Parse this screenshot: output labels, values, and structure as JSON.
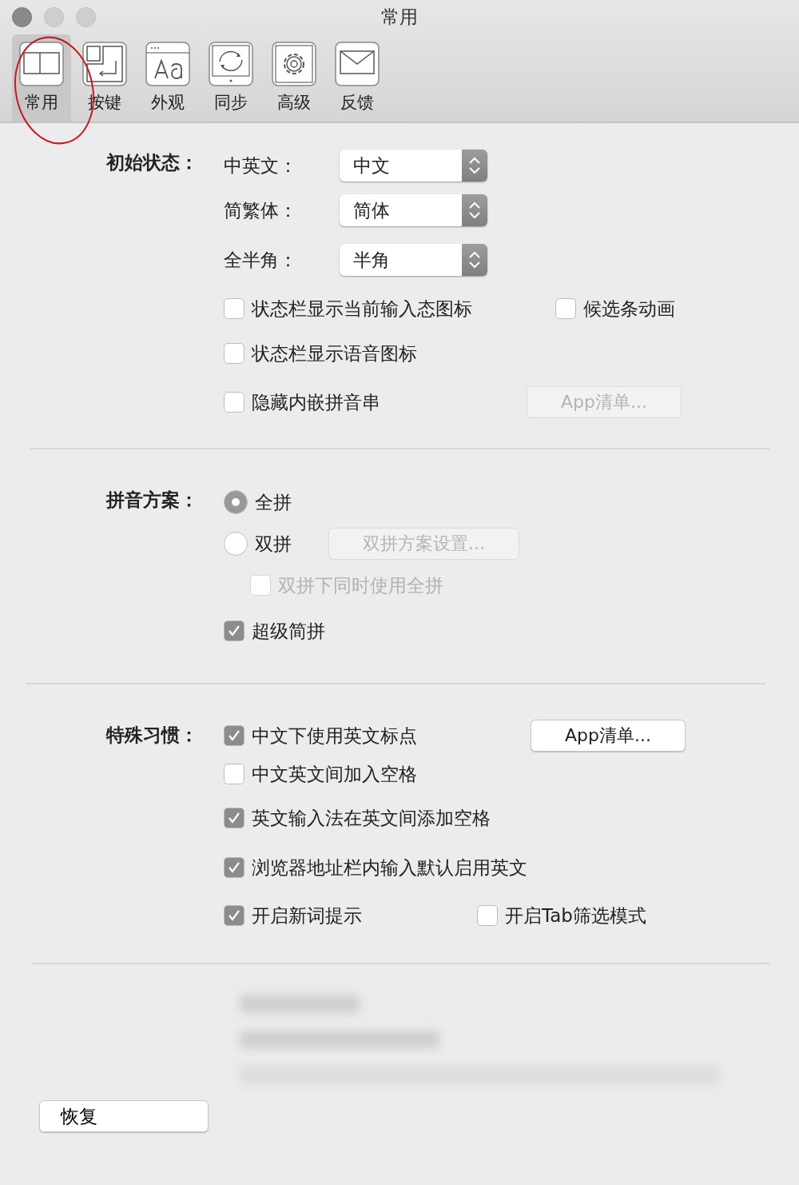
{
  "window": {
    "title": "常用"
  },
  "toolbar": [
    {
      "label": "常用",
      "selected": true
    },
    {
      "label": "按键",
      "selected": false
    },
    {
      "label": "外观",
      "selected": false
    },
    {
      "label": "同步",
      "selected": false
    },
    {
      "label": "高级",
      "selected": false
    },
    {
      "label": "反馈",
      "selected": false
    }
  ],
  "sections": [
    {
      "label": "初始状态：",
      "rows": [
        {
          "kind": "plain",
          "controls": [
            {
              "kind": "popup",
              "label": "中英文：",
              "value": "中文"
            }
          ]
        },
        {
          "kind": "plain",
          "controls": [
            {
              "kind": "popup",
              "label": "简繁体：",
              "value": "简体"
            }
          ]
        },
        {
          "kind": "plain",
          "controls": [
            {
              "kind": "popup",
              "label": "全半角：",
              "value": "半角"
            }
          ]
        },
        {
          "kind": "plain",
          "controls": [
            {
              "kind": "checkbox",
              "label": "状态栏显示当前输入态图标",
              "checked": false,
              "disabled": false
            },
            {
              "kind": "checkbox",
              "label": "候选条动画",
              "checked": false,
              "disabled": false
            }
          ]
        },
        {
          "kind": "plain",
          "controls": [
            {
              "kind": "checkbox",
              "label": "状态栏显示语音图标",
              "checked": false,
              "disabled": false
            }
          ]
        },
        {
          "kind": "plain",
          "controls": [
            {
              "kind": "checkbox",
              "label": "隐藏内嵌拼音串",
              "checked": false,
              "disabled": false
            },
            {
              "kind": "button",
              "label": "App清单...",
              "disabled": true
            }
          ]
        }
      ]
    },
    {
      "label": "拼音方案：",
      "rows": [
        {
          "kind": "plain",
          "controls": [
            {
              "kind": "radio",
              "label": "全拼",
              "selected": true,
              "disabled": false
            }
          ]
        },
        {
          "kind": "plain",
          "controls": [
            {
              "kind": "radio",
              "label": "双拼",
              "selected": false,
              "disabled": false
            },
            {
              "kind": "button",
              "label": "双拼方案设置...",
              "disabled": true
            }
          ]
        },
        {
          "kind": "nested",
          "controls": [
            {
              "kind": "checkbox",
              "label": "双拼下同时使用全拼",
              "checked": false,
              "disabled": true
            }
          ]
        },
        {
          "kind": "plain",
          "controls": [
            {
              "kind": "checkbox",
              "label": "超级简拼",
              "checked": true,
              "disabled": false
            }
          ]
        }
      ]
    },
    {
      "label": "特殊习惯：",
      "rows": [
        {
          "kind": "plain",
          "controls": [
            {
              "kind": "checkbox",
              "label": "中文下使用英文标点",
              "checked": true,
              "disabled": false
            },
            {
              "kind": "button",
              "label": "App清单...",
              "disabled": false
            }
          ]
        },
        {
          "kind": "plain",
          "controls": [
            {
              "kind": "checkbox",
              "label": "中文英文间加入空格",
              "checked": false,
              "disabled": false
            }
          ]
        },
        {
          "kind": "plain",
          "controls": [
            {
              "kind": "checkbox",
              "label": "英文输入法在英文间添加空格",
              "checked": true,
              "disabled": false
            }
          ]
        },
        {
          "kind": "plain",
          "controls": [
            {
              "kind": "checkbox",
              "label": "浏览器地址栏内输入默认启用英文",
              "checked": true,
              "disabled": false
            }
          ]
        },
        {
          "kind": "plain",
          "controls": [
            {
              "kind": "checkbox",
              "label": "开启新词提示",
              "checked": true,
              "disabled": false
            },
            {
              "kind": "checkbox",
              "label": "开启Tab筛选模式",
              "checked": false,
              "disabled": false
            }
          ]
        }
      ]
    }
  ],
  "restore_button": {
    "label": "恢复"
  }
}
